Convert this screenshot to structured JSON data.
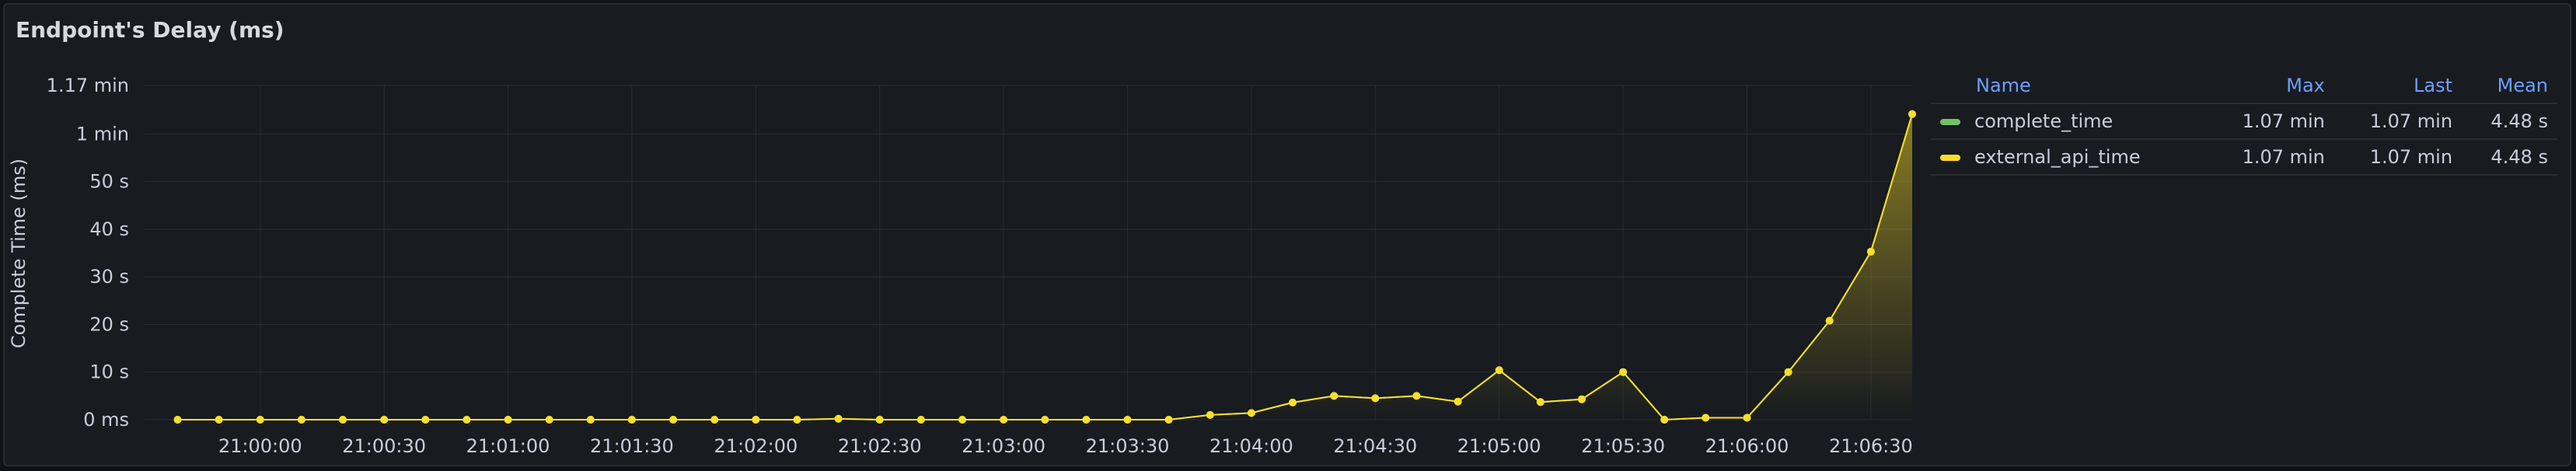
{
  "panel": {
    "title": "Endpoint's Delay (ms)"
  },
  "colors": {
    "complete_time": "#73bf69",
    "external_api_time": "#fade2a",
    "grid": "#2a2c33",
    "background": "#181b1f"
  },
  "legend": {
    "headers": {
      "name": "Name",
      "max": "Max",
      "last": "Last",
      "mean": "Mean"
    },
    "rows": [
      {
        "name": "complete_time",
        "color": "#73bf69",
        "max": "1.07 min",
        "last": "1.07 min",
        "mean": "4.48 s"
      },
      {
        "name": "external_api_time",
        "color": "#fade2a",
        "max": "1.07 min",
        "last": "1.07 min",
        "mean": "4.48 s"
      }
    ]
  },
  "chart_data": {
    "type": "area",
    "ylabel": "Complete Time (ms)",
    "ylim": [
      0,
      70200
    ],
    "y_ticks": [
      {
        "value": 0,
        "label": "0 ms"
      },
      {
        "value": 10000,
        "label": "10 s"
      },
      {
        "value": 20000,
        "label": "20 s"
      },
      {
        "value": 30000,
        "label": "30 s"
      },
      {
        "value": 40000,
        "label": "40 s"
      },
      {
        "value": 50000,
        "label": "50 s"
      },
      {
        "value": 60000,
        "label": "1 min"
      },
      {
        "value": 70200,
        "label": "1.17 min"
      }
    ],
    "x_ticks": [
      "21:00:00",
      "21:00:30",
      "21:01:00",
      "21:01:30",
      "21:02:00",
      "21:02:30",
      "21:03:00",
      "21:03:30",
      "21:04:00",
      "21:04:30",
      "21:05:00",
      "21:05:30",
      "21:06:00",
      "21:06:30"
    ],
    "x": [
      "20:59:40",
      "20:59:50",
      "21:00:00",
      "21:00:10",
      "21:00:20",
      "21:00:30",
      "21:00:40",
      "21:00:50",
      "21:01:00",
      "21:01:10",
      "21:01:20",
      "21:01:30",
      "21:01:40",
      "21:01:50",
      "21:02:00",
      "21:02:10",
      "21:02:20",
      "21:02:30",
      "21:02:40",
      "21:02:50",
      "21:03:00",
      "21:03:10",
      "21:03:20",
      "21:03:30",
      "21:03:40",
      "21:03:50",
      "21:04:00",
      "21:04:10",
      "21:04:20",
      "21:04:30",
      "21:04:40",
      "21:04:50",
      "21:05:00",
      "21:05:10",
      "21:05:20",
      "21:05:30",
      "21:05:40",
      "21:05:50",
      "21:06:00",
      "21:06:10",
      "21:06:20",
      "21:06:30",
      "21:06:40"
    ],
    "series": [
      {
        "name": "complete_time",
        "color": "#73bf69",
        "values": [
          0,
          0,
          0,
          0,
          0,
          0,
          0,
          0,
          0,
          0,
          0,
          0,
          0,
          0,
          0,
          0,
          200,
          0,
          0,
          0,
          0,
          0,
          0,
          0,
          0,
          1000,
          1400,
          3600,
          5000,
          4500,
          5000,
          3800,
          10400,
          3700,
          4300,
          10000,
          0,
          400,
          400,
          10000,
          20800,
          35300,
          64200
        ]
      },
      {
        "name": "external_api_time",
        "color": "#fade2a",
        "values": [
          0,
          0,
          0,
          0,
          0,
          0,
          0,
          0,
          0,
          0,
          0,
          0,
          0,
          0,
          0,
          0,
          200,
          0,
          0,
          0,
          0,
          0,
          0,
          0,
          0,
          1000,
          1400,
          3600,
          5000,
          4500,
          5000,
          3800,
          10400,
          3700,
          4300,
          10000,
          0,
          400,
          400,
          10000,
          20800,
          35300,
          64200
        ]
      }
    ]
  }
}
